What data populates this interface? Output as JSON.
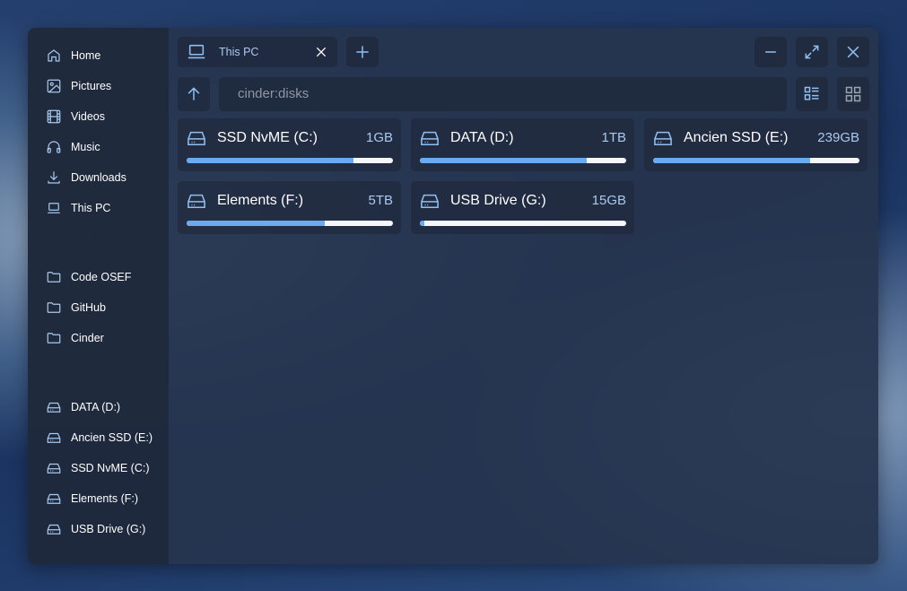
{
  "sidebar": {
    "places": [
      {
        "label": "Home",
        "icon": "home-icon"
      },
      {
        "label": "Pictures",
        "icon": "image-icon"
      },
      {
        "label": "Videos",
        "icon": "film-icon"
      },
      {
        "label": "Music",
        "icon": "headphones-icon"
      },
      {
        "label": "Downloads",
        "icon": "download-icon"
      },
      {
        "label": "This PC",
        "icon": "laptop-icon"
      }
    ],
    "favorites": [
      {
        "label": "Code OSEF"
      },
      {
        "label": "GitHub"
      },
      {
        "label": "Cinder"
      }
    ],
    "drives": [
      {
        "label": "DATA (D:)"
      },
      {
        "label": "Ancien SSD (E:)"
      },
      {
        "label": "SSD NvME (C:)"
      },
      {
        "label": "Elements (F:)"
      },
      {
        "label": "USB Drive (G:)"
      }
    ]
  },
  "tab": {
    "label": "This PC"
  },
  "address": {
    "value": "cinder:disks"
  },
  "accent": "#6aaaf0",
  "disks": [
    {
      "name": "SSD NvME (C:)",
      "size": "1GB",
      "used": 0.81
    },
    {
      "name": "DATA (D:)",
      "size": "1TB",
      "used": 0.81
    },
    {
      "name": "Ancien SSD (E:)",
      "size": "239GB",
      "used": 0.76
    },
    {
      "name": "Elements (F:)",
      "size": "5TB",
      "used": 0.67
    },
    {
      "name": "USB Drive (G:)",
      "size": "15GB",
      "used": 0.02
    }
  ]
}
